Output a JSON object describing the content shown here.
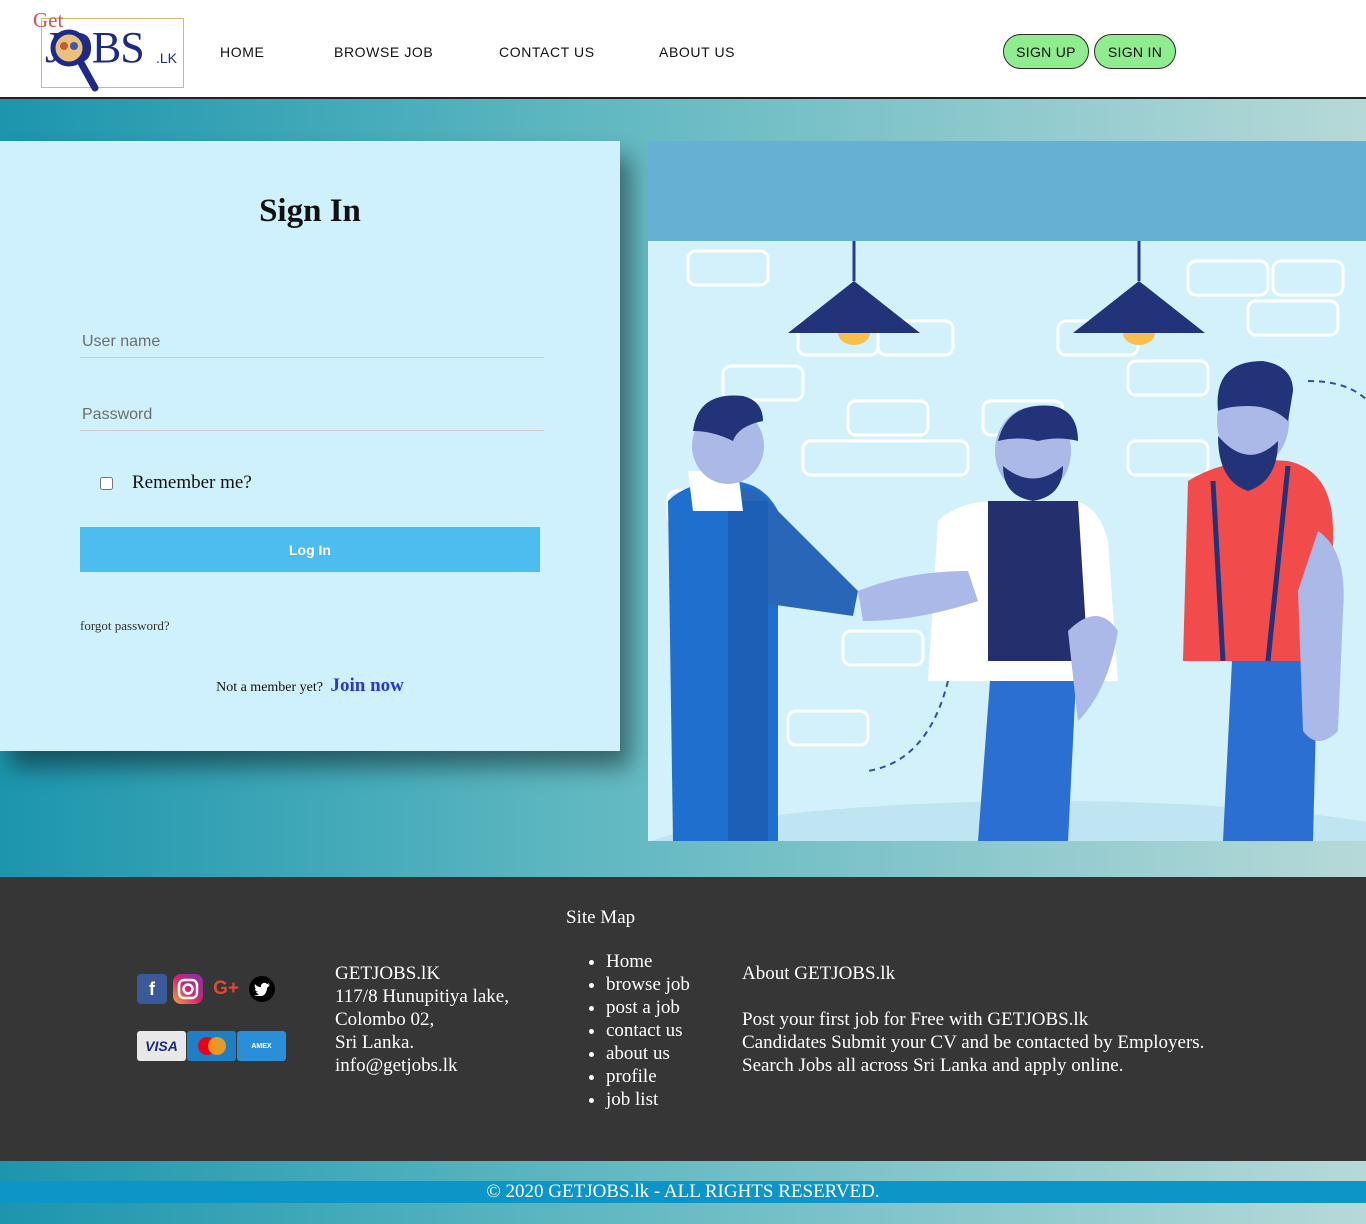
{
  "header": {
    "logo": {
      "get": "Get",
      "jobs": "JOBS",
      "lk": ".LK"
    },
    "nav": [
      {
        "label": "HOME"
      },
      {
        "label": "BROWSE JOB"
      },
      {
        "label": "CONTACT US"
      },
      {
        "label": "ABOUT US"
      }
    ],
    "signup_label": "SIGN UP",
    "signin_label": "SIGN IN"
  },
  "signin": {
    "title": "Sign In",
    "username_placeholder": "User name",
    "password_placeholder": "Password",
    "remember_label": "Remember me?",
    "remember_checked": false,
    "login_label": "Log In",
    "forgot_label": "forgot password?",
    "member_text": "Not a member yet?",
    "join_label": "Join now"
  },
  "footer": {
    "social_icons": [
      "facebook-icon",
      "instagram-icon",
      "google-plus-icon",
      "twitter-icon"
    ],
    "payment_icons": [
      "visa-icon",
      "mastercard-icon",
      "american-express-icon"
    ],
    "address": {
      "company": "GETJOBS.lK",
      "line1": "117/8 Hunupitiya lake,",
      "line2": "Colombo 02,",
      "line3": "Sri Lanka.",
      "email": "info@getjobs.lk"
    },
    "sitemap_title": "Site Map",
    "sitemap": [
      "Home",
      "browse job",
      "post a job",
      "contact us",
      "about us",
      "profile",
      "job list"
    ],
    "about_title": "About GETJOBS.lk",
    "about_lines": [
      "Post your first job for Free with GETJOBS.lk",
      "Candidates Submit your CV and be contacted by Employers.",
      "Search Jobs all across Sri Lanka and apply online."
    ],
    "copyright": "© 2020 GETJOBS.lk - ALL RIGHTS RESERVED."
  },
  "colors": {
    "signin_card": "#cff1fd",
    "login_button": "#4dbdef",
    "auth_button": "#8fec8f",
    "footer_bg": "#363636",
    "copyright_bar": "#0e95c8",
    "join_link": "#2b36d8"
  }
}
